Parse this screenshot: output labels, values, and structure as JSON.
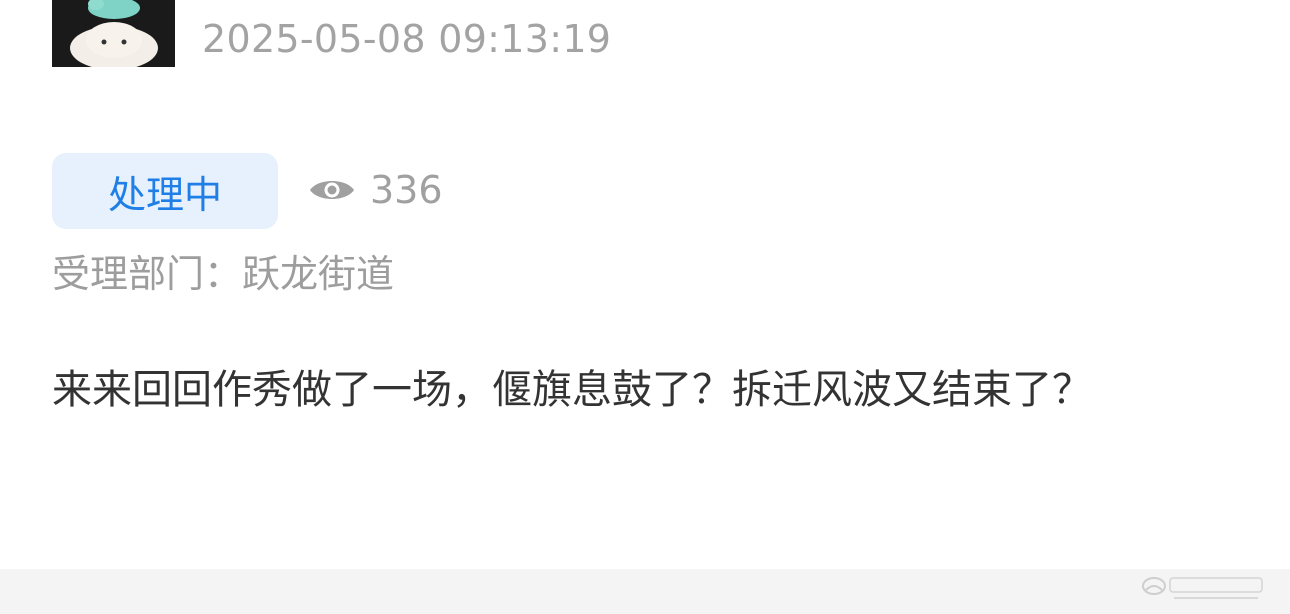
{
  "post": {
    "timestamp": "2025-05-08 09:13:19",
    "status": "处理中",
    "views": "336",
    "department_label": "受理部门：跃龙街道",
    "content": "来来回回作秀做了一场，偃旗息鼓了？拆迁风波又结束了？"
  },
  "icons": {
    "views": "eye-icon"
  },
  "colors": {
    "status_text": "#1f7fe6",
    "status_bg": "#e6f1fd",
    "muted_text": "#a3a3a3",
    "body_text": "#333333"
  }
}
